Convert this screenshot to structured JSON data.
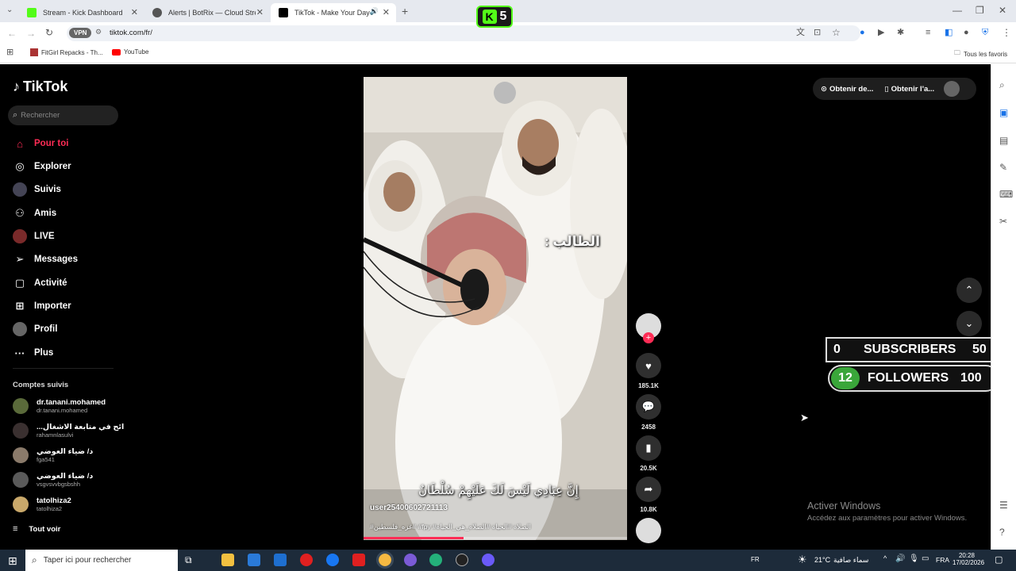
{
  "browser": {
    "tabs": [
      {
        "label": "Stream - Kick Dashboard",
        "color": "#53fc18"
      },
      {
        "label": "Alerts | BotRix — Cloud Stream",
        "color": "#444"
      },
      {
        "label": "TikTok - Make Your Day",
        "color": "#000"
      }
    ],
    "kick_badge": {
      "letter": "K",
      "count": "5"
    },
    "url": "tiktok.com/fr/",
    "vpn_label": "VPN",
    "bookmarks": [
      "FitGirl Repacks - Th...",
      "YouTube"
    ],
    "bookmarks_all": "Tous les favoris"
  },
  "tiktok": {
    "logo": "TikTok",
    "search_placeholder": "Rechercher",
    "nav": [
      {
        "label": "Pour toi",
        "icon": "home-icon",
        "active": true
      },
      {
        "label": "Explorer",
        "icon": "compass-icon"
      },
      {
        "label": "Suivis",
        "icon": "following-avatar-icon"
      },
      {
        "label": "Amis",
        "icon": "friends-icon"
      },
      {
        "label": "LIVE",
        "icon": "live-icon"
      },
      {
        "label": "Messages",
        "icon": "messages-icon"
      },
      {
        "label": "Activité",
        "icon": "activity-icon"
      },
      {
        "label": "Importer",
        "icon": "upload-icon"
      },
      {
        "label": "Profil",
        "icon": "profile-avatar-icon"
      },
      {
        "label": "Plus",
        "icon": "more-icon"
      }
    ],
    "following_title": "Comptes suivis",
    "accounts": [
      {
        "name": "dr.tanani.mohamed",
        "handle": "dr.tanani.mohamed"
      },
      {
        "name": "...ائح في متابعة الاشغال",
        "handle": "rahamnlasulvi"
      },
      {
        "name": "د/ ضياء العوضي",
        "handle": "fga541"
      },
      {
        "name": "د/ ضياء العوضي",
        "handle": "vsgvsvvbgsbshh"
      },
      {
        "name": "tatolhiza2",
        "handle": "tatolhiza2"
      }
    ],
    "see_all": "Tout voir",
    "video": {
      "overlay_title": "الطالب :",
      "caption_arabic": "إِنَّ عِبَادِي لَيْسَ لَكَ عَلَيْهِمْ سُلْطَانٌ",
      "username": "user25400602721113",
      "hashtags": "#غزه_فلسطين# #fpy #الصلاة #الحياة #الصلاه_هي_الحياه",
      "progress": 0.38
    },
    "actions": {
      "likes": "185.1K",
      "comments": "2458",
      "saves": "20.5K",
      "shares": "10.8K"
    },
    "top_right": {
      "get_desktop": "Obtenir de...",
      "get_app": "Obtenir l'a..."
    }
  },
  "overlay": {
    "subs_count": "0",
    "subs_label": "SUBSCRIBERS",
    "subs_goal": "50",
    "followers_count": "12",
    "followers_label": "FOLLOWERS",
    "followers_goal": "100"
  },
  "watermark": {
    "title": "Activer Windows",
    "subtitle": "Accédez aux paramètres pour activer Windows."
  },
  "taskbar": {
    "search_placeholder": "Taper ici pour rechercher",
    "weather": "21°C",
    "weather_text": "سماء صافية",
    "lang": "FRA",
    "fr": "FR",
    "time": "20:28",
    "date": "17/02/2026"
  }
}
